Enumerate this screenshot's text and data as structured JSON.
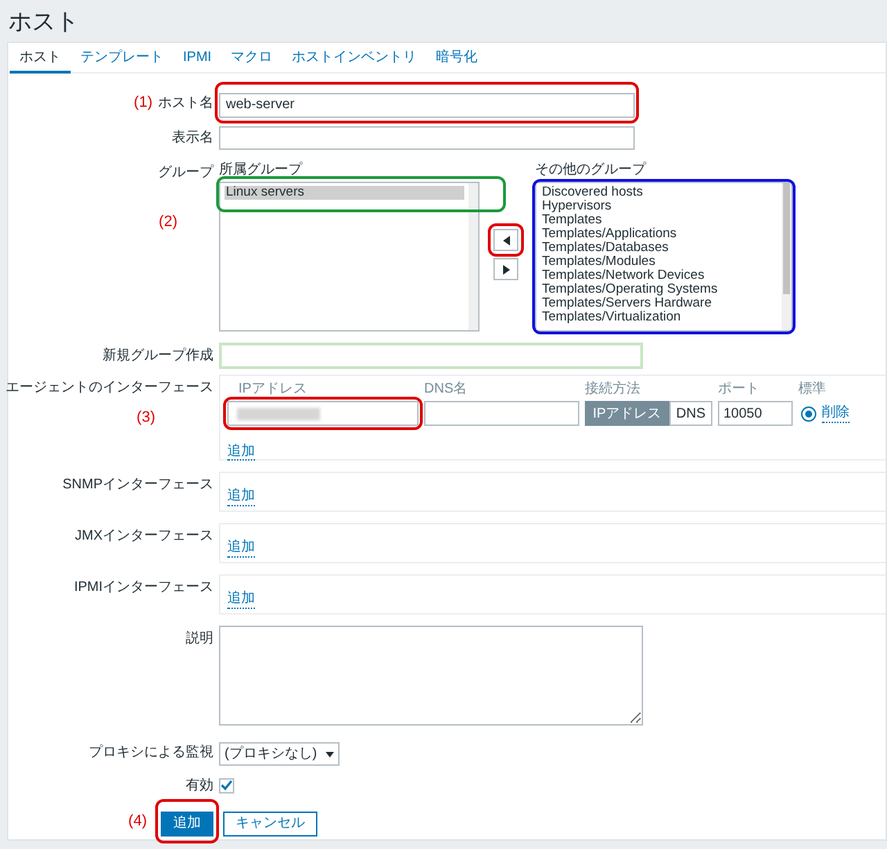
{
  "title": "ホスト",
  "tabs": [
    {
      "label": "ホスト",
      "selected": true
    },
    {
      "label": "テンプレート",
      "selected": false
    },
    {
      "label": "IPMI",
      "selected": false
    },
    {
      "label": "マクロ",
      "selected": false
    },
    {
      "label": "ホストインベントリ",
      "selected": false
    },
    {
      "label": "暗号化",
      "selected": false
    }
  ],
  "host_name": {
    "label": "ホスト名",
    "value": "web-server",
    "marker": "(1)",
    "color": "#e00000"
  },
  "display_name": {
    "label": "表示名"
  },
  "groups": {
    "label": "グループ",
    "marker": "(2)",
    "in_groups": {
      "heading": "所属グループ",
      "color": "#1a9a3a",
      "items": [
        {
          "label": "Linux servers",
          "selected": true
        }
      ]
    },
    "move_buttons": [
      {
        "kind": "left",
        "color": "#e00000"
      },
      {
        "kind": "right"
      }
    ],
    "other_groups": {
      "heading": "その他のグループ",
      "color": "#1010e0",
      "items": [
        {
          "label": "Discovered hosts",
          "selected": false
        },
        {
          "label": "Hypervisors",
          "selected": false
        },
        {
          "label": "Templates",
          "selected": false
        },
        {
          "label": "Templates/Applications",
          "selected": false
        },
        {
          "label": "Templates/Databases",
          "selected": false
        },
        {
          "label": "Templates/Modules",
          "selected": false
        },
        {
          "label": "Templates/Network Devices",
          "selected": false
        },
        {
          "label": "Templates/Operating Systems",
          "selected": false
        },
        {
          "label": "Templates/Servers Hardware",
          "selected": false
        },
        {
          "label": "Templates/Virtualization",
          "selected": false
        }
      ]
    }
  },
  "new_group": {
    "label": "新規グループ作成"
  },
  "agent_interfaces": {
    "label": "エージェントのインターフェース",
    "marker": "(3)",
    "columns": [
      "IPアドレス",
      "DNS名",
      "接続方法",
      "ポート",
      "標準"
    ],
    "rows": [
      {
        "ip_field": {
          "color": "#e00000"
        },
        "connect_options": [
          {
            "label": "IPアドレス",
            "selected": true
          },
          {
            "label": "DNS",
            "selected": false
          }
        ],
        "port": "10050",
        "default": true,
        "remove": "削除"
      }
    ],
    "add": "追加"
  },
  "other_interfaces": [
    {
      "label": "SNMPインターフェース",
      "add": "追加"
    },
    {
      "label": "JMXインターフェース",
      "add": "追加"
    },
    {
      "label": "IPMIインターフェース",
      "add": "追加"
    }
  ],
  "description": {
    "label": "説明"
  },
  "proxy": {
    "label": "プロキシによる監視",
    "value": "(プロキシなし)"
  },
  "enabled": {
    "label": "有効",
    "checked": true
  },
  "actions": {
    "marker": "(4)",
    "buttons": [
      {
        "label": "追加",
        "kind": "primary",
        "color": "#e00000"
      },
      {
        "label": "キャンセル",
        "kind": "secondary"
      }
    ]
  }
}
